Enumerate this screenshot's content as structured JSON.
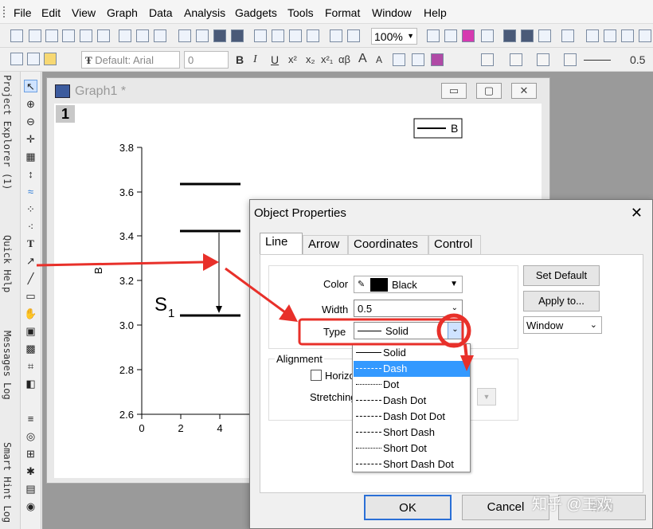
{
  "menu": [
    "File",
    "Edit",
    "View",
    "Graph",
    "Data",
    "Analysis",
    "Gadgets",
    "Tools",
    "Format",
    "Window",
    "Help"
  ],
  "toolbar": {
    "zoom": "100%",
    "font": "Default: Arial",
    "font_size": "0",
    "line_width": "0.5",
    "style_labels": [
      "B",
      "I",
      "U",
      "x²",
      "x₂",
      "x²₁",
      "αβ",
      "A",
      "A"
    ]
  },
  "side_tabs": [
    "Project Explorer (1)",
    "Quick Help",
    "Messages Log",
    "Smart Hint Log"
  ],
  "graph": {
    "window_title": "Graph1 *",
    "layer": "1",
    "legend": "B",
    "y_axis_label": "B",
    "y_ticks": [
      "3.8",
      "3.6",
      "3.4",
      "3.2",
      "3.0",
      "2.8",
      "2.6"
    ],
    "x_ticks": [
      "0",
      "2",
      "4"
    ],
    "annotation": "S",
    "annotation_sub": "1",
    "levels": [
      3.63,
      3.42,
      3.04
    ]
  },
  "dialog": {
    "title": "Object Properties",
    "close": "✕",
    "tabs": [
      "Line",
      "Arrow",
      "Coordinates",
      "Control"
    ],
    "color_label": "Color",
    "color_value": "Black",
    "width_label": "Width",
    "width_value": "0.5",
    "type_label": "Type",
    "type_value": "Solid",
    "alignment_label": "Alignment",
    "horizontal_label": "Horizo",
    "stretching_label": "Stretching",
    "set_default": "Set Default",
    "apply_to": "Apply to...",
    "window_option": "Window",
    "ok": "OK",
    "cancel": "Cancel",
    "hidden_btn": "帮助"
  },
  "type_options": [
    "Solid",
    "Dash",
    "Dot",
    "Dash Dot",
    "Dash Dot Dot",
    "Short Dash",
    "Short Dot",
    "Short Dash Dot"
  ],
  "selected_option": "Dash",
  "watermark": "知乎 @王欢",
  "colors": {
    "accent": "#3399ff",
    "annotation_red": "#e8302a",
    "ok_border": "#2a6fd6"
  }
}
